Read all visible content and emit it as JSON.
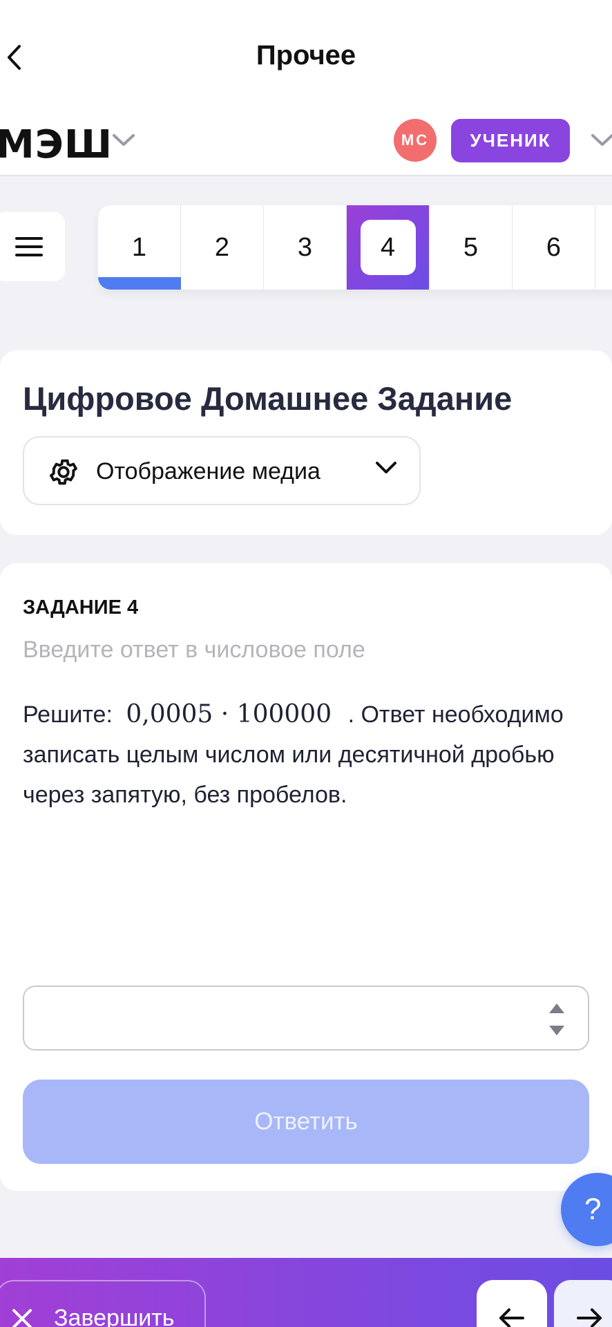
{
  "topnav": {
    "title": "Прочее",
    "back_icon": "chevron-left-icon"
  },
  "header": {
    "brand": "МЭШ",
    "avatar_initials": "МС",
    "role": "УЧЕНИК",
    "colors": {
      "avatar": "#f26d6d",
      "role_badge": "#8a45e0"
    }
  },
  "task_strip": {
    "menu_icon": "hamburger-menu-icon",
    "tabs": [
      {
        "label": "1",
        "state": "done"
      },
      {
        "label": "2",
        "state": "default"
      },
      {
        "label": "3",
        "state": "default"
      },
      {
        "label": "4",
        "state": "active"
      },
      {
        "label": "5",
        "state": "default"
      },
      {
        "label": "6",
        "state": "default"
      }
    ]
  },
  "page": {
    "title": "Цифровое Домашнее Задание",
    "media_button": "Отображение медиа"
  },
  "task": {
    "label": "ЗАДАНИЕ 4",
    "hint": "Введите ответ в числовое поле",
    "text_prefix": "Решите:",
    "expression": "0,0005 · 100000",
    "text_suffix": ". Ответ необходимо записать целым  числом или десятичной дробью через запятую, без пробелов.",
    "answer_value": "",
    "submit_label": "Ответить"
  },
  "help": {
    "label": "?"
  },
  "bottombar": {
    "finish_label": "Завершить",
    "prev_icon": "arrow-left-icon",
    "next_icon": "arrow-right-icon"
  },
  "colors": {
    "accent_blue": "#4f7cf0",
    "submit_disabled": "#a7b7f8",
    "gradient_start": "#a13fd6",
    "gradient_end": "#6b4de3"
  }
}
